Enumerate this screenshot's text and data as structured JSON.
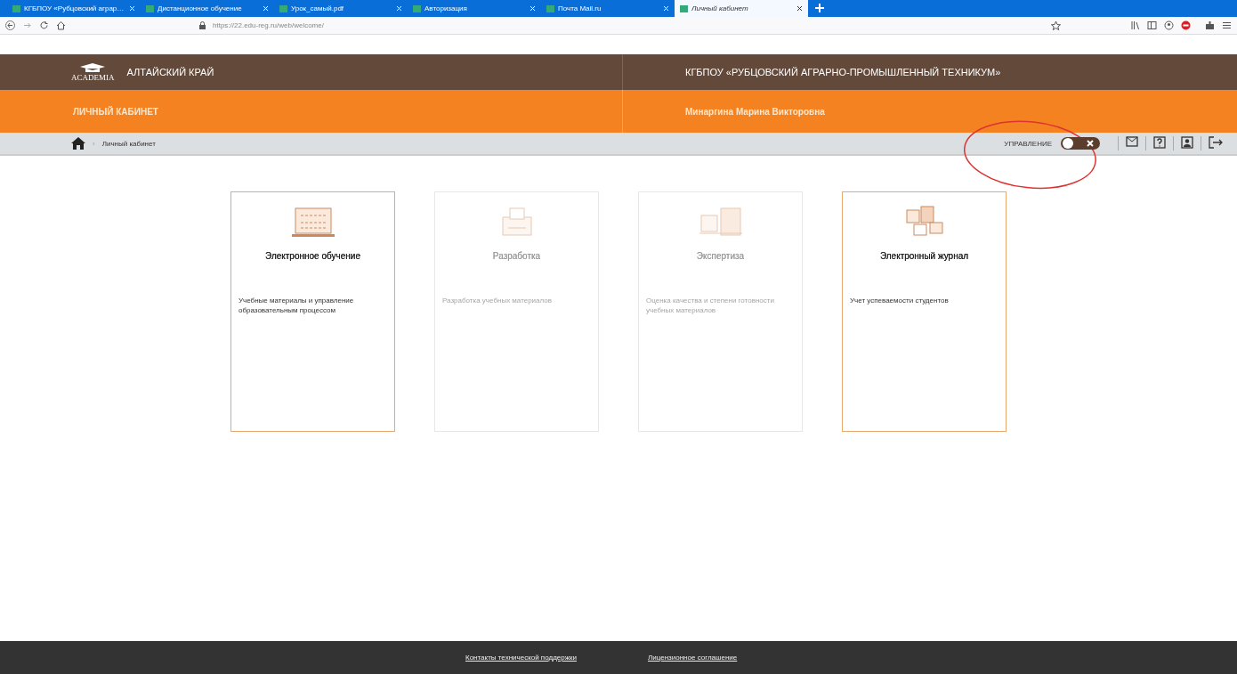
{
  "browser": {
    "tabs": [
      {
        "title": "КГБПОУ «Рубцовский аграр…",
        "selected": false
      },
      {
        "title": "Дистанционное обучение",
        "selected": false
      },
      {
        "title": "Урок_самый.pdf",
        "selected": false
      },
      {
        "title": "Авторизация",
        "selected": false
      },
      {
        "title": "Почта Mail.ru",
        "selected": false
      },
      {
        "title": "Личный кабинет",
        "selected": true
      }
    ],
    "url": "https://22.edu-reg.ru/web/welcome/"
  },
  "header": {
    "logo": "ACADEMIA",
    "region": "АЛТАЙСКИЙ КРАЙ",
    "organization": "КГБПОУ «РУБЦОВСКИЙ АГРАРНО-ПРОМЫШЛЕННЫЙ ТЕХНИКУМ»",
    "section": "ЛИЧНЫЙ КАБИНЕТ",
    "user": "Минаргина Марина Викторовна"
  },
  "breadcrumb": {
    "separator": "›",
    "current": "Личный кабинет"
  },
  "management": {
    "label": "УПРАВЛЕНИЕ",
    "on": false
  },
  "cards": [
    {
      "title": "Электронное обучение",
      "description": "Учебные материалы и управление образовательным процессом",
      "disabled": false
    },
    {
      "title": "Разработка",
      "description": "Разработка учебных материалов",
      "disabled": true
    },
    {
      "title": "Экспертиза",
      "description": "Оценка качества и степени готовности учебных материалов",
      "disabled": true
    },
    {
      "title": "Электронный журнал",
      "description": "Учет успеваемости студентов",
      "disabled": false
    }
  ],
  "footer": {
    "links": [
      "Контакты технической поддержки",
      "Лицензионное соглашение"
    ]
  }
}
